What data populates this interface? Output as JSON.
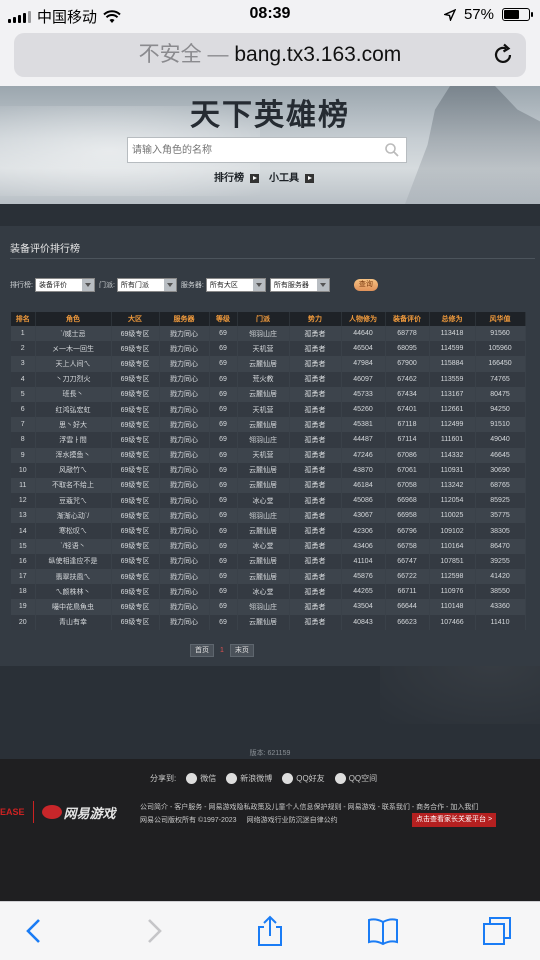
{
  "status_bar": {
    "carrier": "中国移动",
    "time": "08:39",
    "battery": "57%",
    "battery_level": 0.57
  },
  "browser": {
    "insecure_label": "不安全 —",
    "url": "bang.tx3.163.com"
  },
  "banner": {
    "title": "天下英雄榜",
    "search_placeholder": "请输入角色的名称",
    "links": [
      "排行榜",
      "小工具"
    ]
  },
  "panel": {
    "heading": "装备评价排行榜",
    "filters": {
      "rank_label": "排行榜:",
      "rank_value": "装备评价",
      "school_label": "门派:",
      "school_value": "所有门派",
      "server_label": "服务器:",
      "region_value": "所有大区",
      "server_value": "所有服务器",
      "query_button": "查询"
    }
  },
  "table": {
    "headers": [
      "排名",
      "角色",
      "大区",
      "服务器",
      "等级",
      "门派",
      "势力",
      "人物修为",
      "装备评价",
      "总修为",
      "风华值"
    ],
    "rows": [
      [
        "1",
        "ˋ/威士忌",
        "69级专区",
        "戮力同心",
        "69",
        "翎羽山庄",
        "孤勇者",
        "44640",
        "68778",
        "113418",
        "91560"
      ],
      [
        "2",
        "メ一木一回生",
        "69级专区",
        "戮力同心",
        "69",
        "天机营",
        "孤勇者",
        "46504",
        "68095",
        "114599",
        "105960"
      ],
      [
        "3",
        "天上人间ㄟ",
        "69级专区",
        "戮力同心",
        "69",
        "云麓仙居",
        "孤勇者",
        "47984",
        "67900",
        "115884",
        "166450"
      ],
      [
        "4",
        "丶刀刀烈火",
        "69级专区",
        "戮力同心",
        "69",
        "荒火教",
        "孤勇者",
        "46097",
        "67462",
        "113559",
        "74765"
      ],
      [
        "5",
        "班長丶",
        "69级专区",
        "戮力同心",
        "69",
        "云麓仙居",
        "孤勇者",
        "45733",
        "67434",
        "113167",
        "80475"
      ],
      [
        "6",
        "红鸿弘宏虹",
        "69级专区",
        "戮力同心",
        "69",
        "天机营",
        "孤勇者",
        "45260",
        "67401",
        "112661",
        "94250"
      ],
      [
        "7",
        "思丶好大",
        "69级专区",
        "戮力同心",
        "69",
        "云麓仙居",
        "孤勇者",
        "45381",
        "67118",
        "112499",
        "91510"
      ],
      [
        "8",
        "浮雲ㅏ間",
        "69级专区",
        "戮力同心",
        "69",
        "翎羽山庄",
        "孤勇者",
        "44487",
        "67114",
        "111601",
        "49040"
      ],
      [
        "9",
        "浑水摸鱼丶",
        "69级专区",
        "戮力同心",
        "69",
        "天机营",
        "孤勇者",
        "47246",
        "67086",
        "114332",
        "46645"
      ],
      [
        "10",
        "风敲竹ㄟ",
        "69级专区",
        "戮力同心",
        "69",
        "云麓仙居",
        "孤勇者",
        "43870",
        "67061",
        "110931",
        "30690"
      ],
      [
        "11",
        "不取名不给上",
        "69级专区",
        "戮力同心",
        "69",
        "云麓仙居",
        "孤勇者",
        "46184",
        "67058",
        "113242",
        "68765"
      ],
      [
        "12",
        "豆蔻咒ㄟ",
        "69级专区",
        "戮力同心",
        "69",
        "冰心堂",
        "孤勇者",
        "45086",
        "66968",
        "112054",
        "85925"
      ],
      [
        "13",
        "渐渐心动ˋ/",
        "69级专区",
        "戮力同心",
        "69",
        "翎羽山庄",
        "孤勇者",
        "43067",
        "66958",
        "110025",
        "35775"
      ],
      [
        "14",
        "寒松叹ㄟ",
        "69级专区",
        "戮力同心",
        "69",
        "云麓仙居",
        "孤勇者",
        "42306",
        "66796",
        "109102",
        "38305"
      ],
      [
        "15",
        "ˋ/轻语丶",
        "69级专区",
        "戮力同心",
        "69",
        "冰心堂",
        "孤勇者",
        "43406",
        "66758",
        "110164",
        "86470"
      ],
      [
        "16",
        "纵使相逢应不是",
        "69级专区",
        "戮力同心",
        "69",
        "云麓仙居",
        "孤勇者",
        "41104",
        "66747",
        "107851",
        "39255"
      ],
      [
        "17",
        "翡翠扶風ㄟ",
        "69级专区",
        "戮力同心",
        "69",
        "云麓仙居",
        "孤勇者",
        "45876",
        "66722",
        "112598",
        "41420"
      ],
      [
        "18",
        "ㄟ颜株林丶",
        "69级专区",
        "戮力同心",
        "69",
        "冰心堂",
        "孤勇者",
        "44265",
        "66711",
        "110976",
        "38550"
      ],
      [
        "19",
        "嘬中花鳥魚虫",
        "69级专区",
        "戮力同心",
        "69",
        "翎羽山庄",
        "孤勇者",
        "43504",
        "66644",
        "110148",
        "43360"
      ],
      [
        "20",
        "青山有幸",
        "69级专区",
        "戮力同心",
        "69",
        "云麓仙居",
        "孤勇者",
        "40843",
        "66623",
        "107466",
        "11410"
      ]
    ]
  },
  "pager": {
    "first": "首页",
    "current": "1",
    "last": "末页"
  },
  "version": "版本: 621159",
  "footer": {
    "share_label": "分享到:",
    "share_items": [
      "微信",
      "新浪微博",
      "QQ好友",
      "QQ空间"
    ],
    "ease_mark": "EASE",
    "brand": "网易游戏",
    "links_line1": "公司简介 - 客户服务 - 网易游戏隐私政策及儿童个人信息保护规则 - 网易游戏 - 联系我们 - 商务合作 - 加入我们",
    "copyright": "网易公司版权所有 ©1997-2023",
    "self_discipline": "网络游戏行业防沉迷自律公约",
    "parent_button": "点击查看家长关爱平台 >"
  }
}
